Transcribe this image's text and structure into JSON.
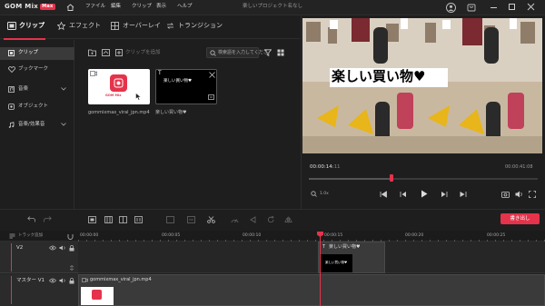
{
  "app": {
    "logo": "GOM Mix",
    "logo_badge": "Max",
    "window_title": "楽しいプロジェクト名なし"
  },
  "menu": [
    "ファイル",
    "編集",
    "クリップ",
    "表示",
    "ヘルプ"
  ],
  "tabs": [
    "クリップ",
    "エフェクト",
    "オーバーレイ",
    "トランジション"
  ],
  "sidebar": {
    "items": [
      "クリップ",
      "ブックマーク",
      "音楽",
      "オブジェクト",
      "音楽/効果音"
    ]
  },
  "clip_toolbar": {
    "add_label": "クリップを追加",
    "search_placeholder": "検索語を入力してくださ"
  },
  "clips": [
    {
      "name": "gommixmax_viral_jpn.mp4"
    },
    {
      "name": "楽しい買い物♥",
      "thumb_text": "楽しい買い物♥"
    }
  ],
  "preview": {
    "caption": "楽しい買い物♥",
    "current_time": "00:00:14",
    "current_frames": "11",
    "total_time": "00:00:41",
    "total_frames": "08",
    "speed": "1.0x",
    "progress": 0.36
  },
  "timeline": {
    "export_label": "書き出し",
    "track_add_label": "トラック追加",
    "ruler_labels": [
      "00:00:00",
      "00:00:05",
      "00:00:10",
      "00:00:15",
      "00:00:20",
      "00:00:25"
    ],
    "tracks": [
      {
        "name": "V2",
        "clip_label": "楽しい買い物♥"
      },
      {
        "name": "マスター V1",
        "clip_label": "gommixmax_viral_jpn.mp4"
      }
    ]
  },
  "colors": {
    "accent": "#e5334b",
    "bg": "#1e1e1e"
  }
}
